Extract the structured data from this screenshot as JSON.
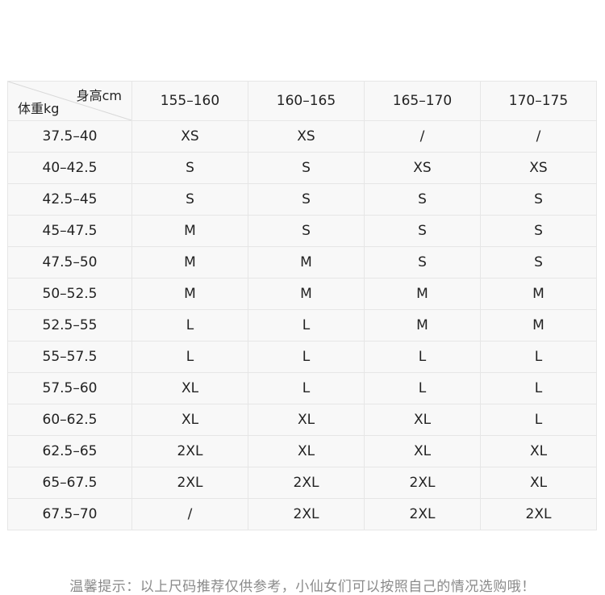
{
  "table": {
    "corner": {
      "height_label": "身高cm",
      "weight_label": "体重kg"
    },
    "height_ranges": [
      "155–160",
      "160–165",
      "165–170",
      "170–175"
    ],
    "rows": [
      {
        "weight": "37.5–40",
        "sizes": [
          "XS",
          "XS",
          "/",
          "/"
        ]
      },
      {
        "weight": "40–42.5",
        "sizes": [
          "S",
          "S",
          "XS",
          "XS"
        ]
      },
      {
        "weight": "42.5–45",
        "sizes": [
          "S",
          "S",
          "S",
          "S"
        ]
      },
      {
        "weight": "45–47.5",
        "sizes": [
          "M",
          "S",
          "S",
          "S"
        ]
      },
      {
        "weight": "47.5–50",
        "sizes": [
          "M",
          "M",
          "S",
          "S"
        ]
      },
      {
        "weight": "50–52.5",
        "sizes": [
          "M",
          "M",
          "M",
          "M"
        ]
      },
      {
        "weight": "52.5–55",
        "sizes": [
          "L",
          "L",
          "M",
          "M"
        ]
      },
      {
        "weight": "55–57.5",
        "sizes": [
          "L",
          "L",
          "L",
          "L"
        ]
      },
      {
        "weight": "57.5–60",
        "sizes": [
          "XL",
          "L",
          "L",
          "L"
        ]
      },
      {
        "weight": "60–62.5",
        "sizes": [
          "XL",
          "XL",
          "XL",
          "L"
        ]
      },
      {
        "weight": "62.5–65",
        "sizes": [
          "2XL",
          "XL",
          "XL",
          "XL"
        ]
      },
      {
        "weight": "65–67.5",
        "sizes": [
          "2XL",
          "2XL",
          "2XL",
          "XL"
        ]
      },
      {
        "weight": "67.5–70",
        "sizes": [
          "/",
          "2XL",
          "2XL",
          "2XL"
        ]
      }
    ]
  },
  "footer": {
    "note": "温馨提示：以上尺码推荐仅供参考，小仙女们可以按照自己的情况选购哦！"
  }
}
